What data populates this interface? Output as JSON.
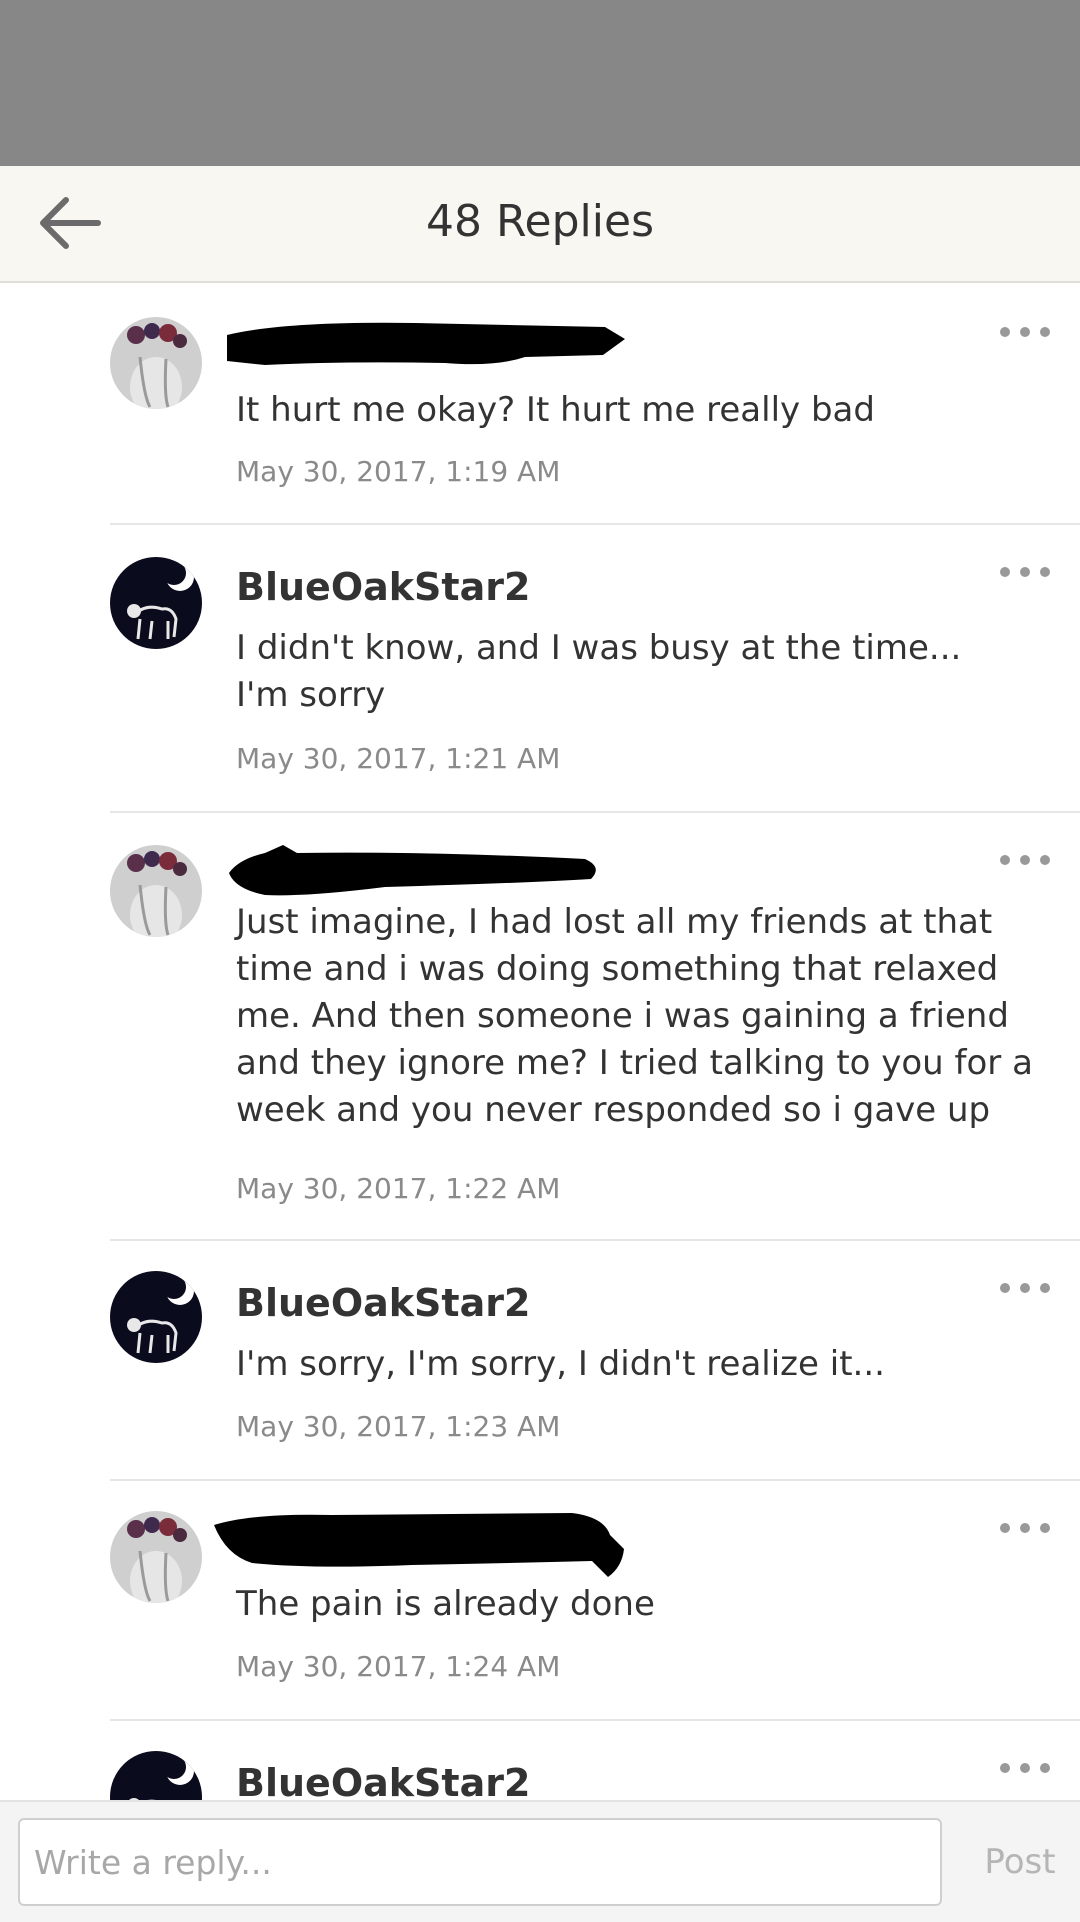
{
  "header": {
    "title": "48 Replies",
    "back_icon": "arrow-left-icon"
  },
  "replies": [
    {
      "author": "",
      "avatar": "flower-crown-girl-avatar",
      "redacted": true,
      "message": "It hurt me okay? It hurt me really bad",
      "timestamp": "May 30, 2017, 1:19 AM"
    },
    {
      "author": "BlueOakStar2",
      "avatar": "moon-cat-avatar",
      "redacted": false,
      "message": "I didn't know, and I was busy at the time...\nI'm sorry",
      "timestamp": "May 30, 2017, 1:21 AM"
    },
    {
      "author": "",
      "avatar": "flower-crown-girl-avatar",
      "redacted": true,
      "message": "Just imagine, I had lost all my friends at that time and i was doing something that relaxed me. And then someone i was gaining a friend and they ignore me? I tried talking to you for a week and you never responded so i gave up",
      "timestamp": "May 30, 2017, 1:22 AM"
    },
    {
      "author": "BlueOakStar2",
      "avatar": "moon-cat-avatar",
      "redacted": false,
      "message": "I'm sorry, I'm sorry, I didn't realize it...",
      "timestamp": "May 30, 2017, 1:23 AM"
    },
    {
      "author": "",
      "avatar": "flower-crown-girl-avatar",
      "redacted": true,
      "message": "The pain is already done",
      "timestamp": "May 30, 2017, 1:24 AM"
    },
    {
      "author": "BlueOakStar2",
      "avatar": "moon-cat-avatar",
      "redacted": false,
      "message": "",
      "timestamp": ""
    }
  ],
  "composer": {
    "placeholder": "Write a reply...",
    "post_label": "Post"
  },
  "colors": {
    "header_bg": "#f8f7f2",
    "statusbar": "#878787",
    "text": "#333333",
    "meta": "#8a8a8a"
  }
}
